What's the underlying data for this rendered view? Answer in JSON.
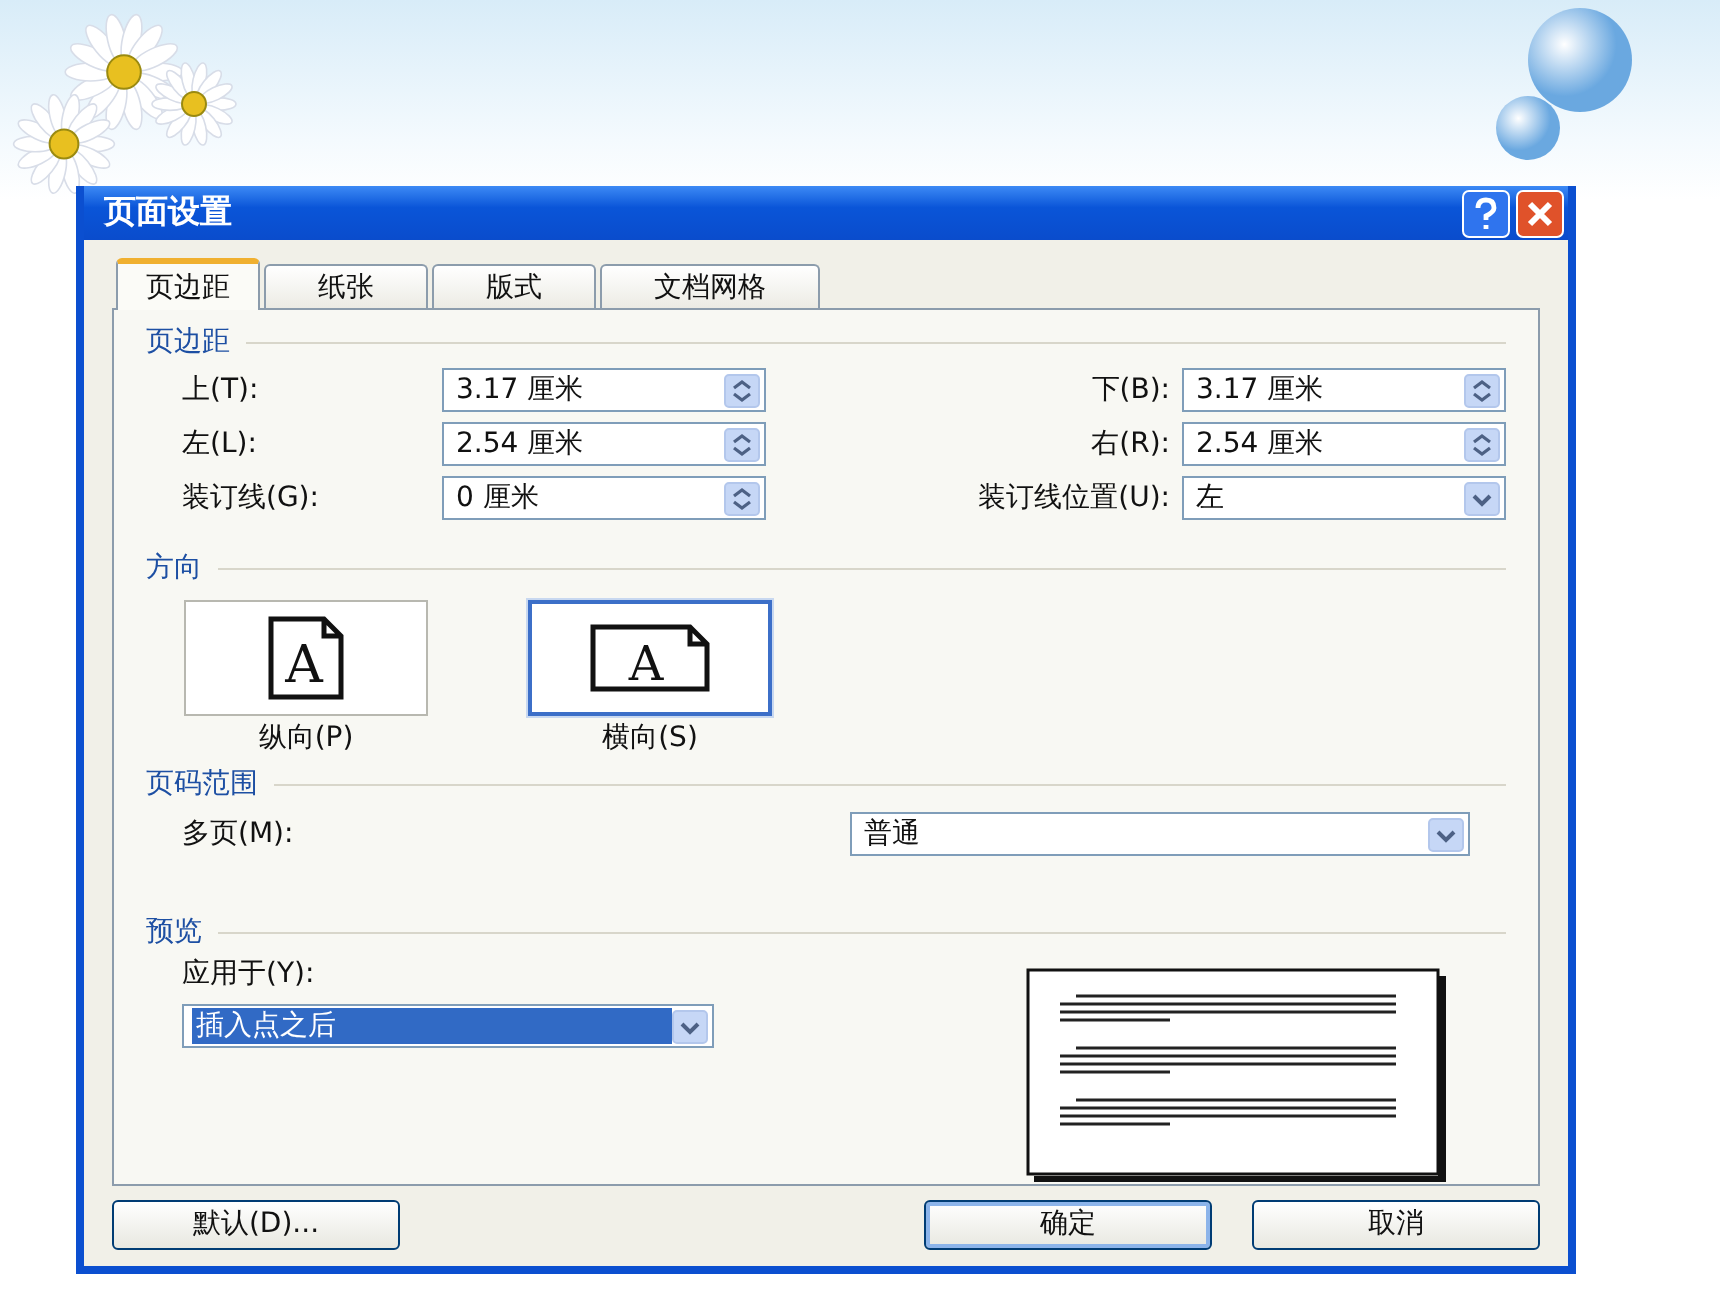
{
  "window": {
    "title": "页面设置"
  },
  "tabs": [
    {
      "label": "页边距",
      "selected": true
    },
    {
      "label": "纸张",
      "selected": false
    },
    {
      "label": "版式",
      "selected": false
    },
    {
      "label": "文档网格",
      "selected": false
    }
  ],
  "margins": {
    "heading": "页边距",
    "fields": [
      {
        "label": "上(T):",
        "value": "3.17 厘米",
        "kind": "spin"
      },
      {
        "label": "下(B):",
        "value": "3.17 厘米",
        "kind": "spin"
      },
      {
        "label": "左(L):",
        "value": "2.54 厘米",
        "kind": "spin"
      },
      {
        "label": "右(R):",
        "value": "2.54 厘米",
        "kind": "spin"
      },
      {
        "label": "装订线(G):",
        "value": "0 厘米",
        "kind": "spin"
      },
      {
        "label": "装订线位置(U):",
        "value": "左",
        "kind": "dropdown"
      }
    ]
  },
  "orientation": {
    "heading": "方向",
    "options": [
      {
        "label": "纵向(P)",
        "glyph": "A",
        "kind": "portrait",
        "selected": false
      },
      {
        "label": "横向(S)",
        "glyph": "A",
        "kind": "landscape",
        "selected": true
      }
    ]
  },
  "pages": {
    "heading": "页码范围",
    "label": "多页(M):",
    "value": "普通"
  },
  "preview": {
    "heading": "预览",
    "label": "应用于(Y):",
    "value": "插入点之后",
    "highlighted": true
  },
  "buttons": [
    {
      "label": "默认(D)...",
      "default": false
    },
    {
      "label": "确定",
      "default": true
    },
    {
      "label": "取消",
      "default": false
    }
  ]
}
